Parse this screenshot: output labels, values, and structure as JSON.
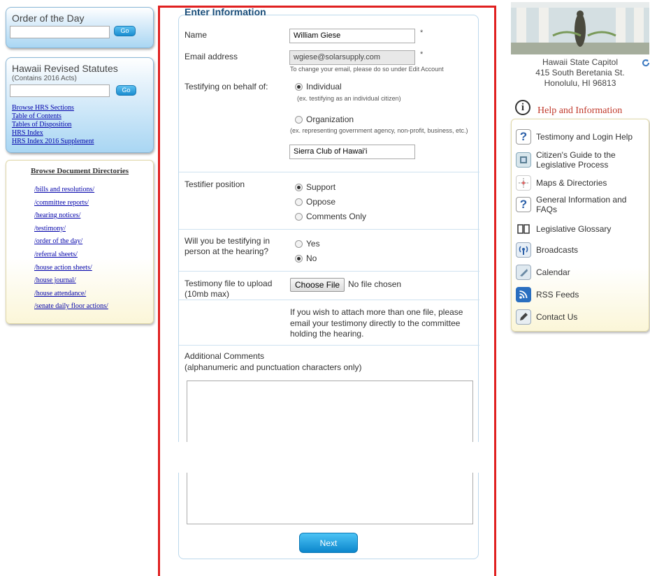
{
  "left": {
    "order_of_day": {
      "title": "Order of the Day",
      "go": "Go"
    },
    "hrs": {
      "title": "Hawaii Revised Statutes",
      "subtitle": "(Contains 2016 Acts)",
      "go": "Go",
      "links": [
        "Browse HRS Sections",
        "Table of Contents",
        "Tables of Disposition",
        "HRS Index",
        "HRS Index 2016 Supplement"
      ]
    },
    "directories": {
      "title": "Browse Document Directories",
      "links": [
        "/bills and resolutions/",
        "/committee reports/",
        "/hearing notices/",
        "/testimony/",
        "/order of the day/",
        "/referral sheets/",
        "/house action sheets/",
        "/house journal/",
        "/house attendance/",
        "/senate daily floor actions/"
      ]
    }
  },
  "form": {
    "header": "Enter Information",
    "name_label": "Name",
    "name_value": "William Giese",
    "email_label": "Email address",
    "email_value": "wgiese@solarsupply.com",
    "email_note": "To change your email, please do so under Edit Account",
    "required_mark": "*",
    "behalf_label": "Testifying on behalf of:",
    "behalf_options": [
      {
        "label": "Individual",
        "note": "(ex. testifying as an individual citizen)",
        "selected": true
      },
      {
        "label": "Organization",
        "note": "(ex. representing government agency, non-profit, business, etc.)",
        "selected": false
      }
    ],
    "org_value": "Sierra Club of Hawai'i",
    "position_label": "Testifier position",
    "position_options": [
      {
        "label": "Support",
        "selected": true
      },
      {
        "label": "Oppose",
        "selected": false
      },
      {
        "label": "Comments Only",
        "selected": false
      }
    ],
    "in_person_label": "Will you be testifying in person at the hearing?",
    "in_person_options": [
      {
        "label": "Yes",
        "selected": false
      },
      {
        "label": "No",
        "selected": true
      }
    ],
    "file_label": "Testimony file to upload (10mb max)",
    "file_button": "Choose File",
    "file_status": "No file chosen",
    "file_note": "If you wish to attach more than one file, please email your testimony directly to the committee holding the hearing.",
    "comments_label": "Additional Comments",
    "comments_sublabel": "(alphanumeric and punctuation characters only)",
    "comments_value": "",
    "next_button": "Next"
  },
  "right": {
    "address": [
      "Hawaii State Capitol",
      "415 South Beretania St.",
      "Honolulu, HI 96813"
    ],
    "help_title": "Help and Information",
    "help_items": [
      {
        "label": "Testimony and Login Help",
        "icon": "question-icon"
      },
      {
        "label": "Citizen's Guide to the Legislative Process",
        "icon": "book-icon"
      },
      {
        "label": "Maps & Directories",
        "icon": "map-icon"
      },
      {
        "label": "General Information and FAQs",
        "icon": "question-icon"
      },
      {
        "label": "Legislative Glossary",
        "icon": "glossary-icon"
      },
      {
        "label": "Broadcasts",
        "icon": "broadcast-icon"
      },
      {
        "label": "Calendar",
        "icon": "calendar-icon"
      },
      {
        "label": "RSS Feeds",
        "icon": "rss-icon"
      },
      {
        "label": "Contact Us",
        "icon": "pen-icon"
      }
    ]
  }
}
